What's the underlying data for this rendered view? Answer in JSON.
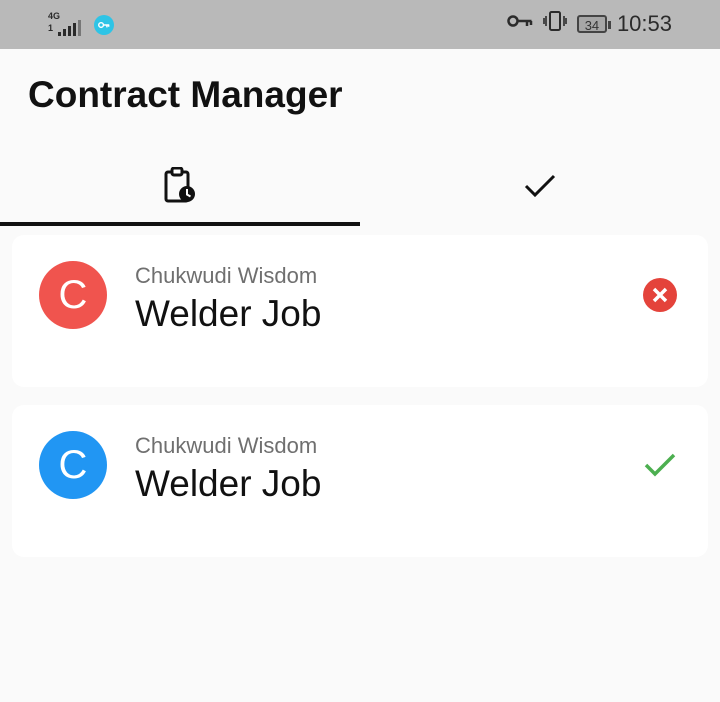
{
  "status_bar": {
    "network_label": "4G",
    "network_sub": "1",
    "battery": "34",
    "time": "10:53"
  },
  "app": {
    "title": "Contract Manager"
  },
  "tabs": [
    {
      "name": "pending",
      "icon": "clipboard-clock-icon",
      "selected": true
    },
    {
      "name": "completed",
      "icon": "check-icon",
      "selected": false
    }
  ],
  "contracts": [
    {
      "avatar_letter": "C",
      "avatar_color": "#f0544e",
      "sender": "Chukwudi Wisdom",
      "job": "Welder Job",
      "status": "rejected",
      "status_color": "#e4433b"
    },
    {
      "avatar_letter": "C",
      "avatar_color": "#2196f3",
      "sender": "Chukwudi Wisdom",
      "job": "Welder Job",
      "status": "accepted",
      "status_color": "#4caf50"
    }
  ]
}
